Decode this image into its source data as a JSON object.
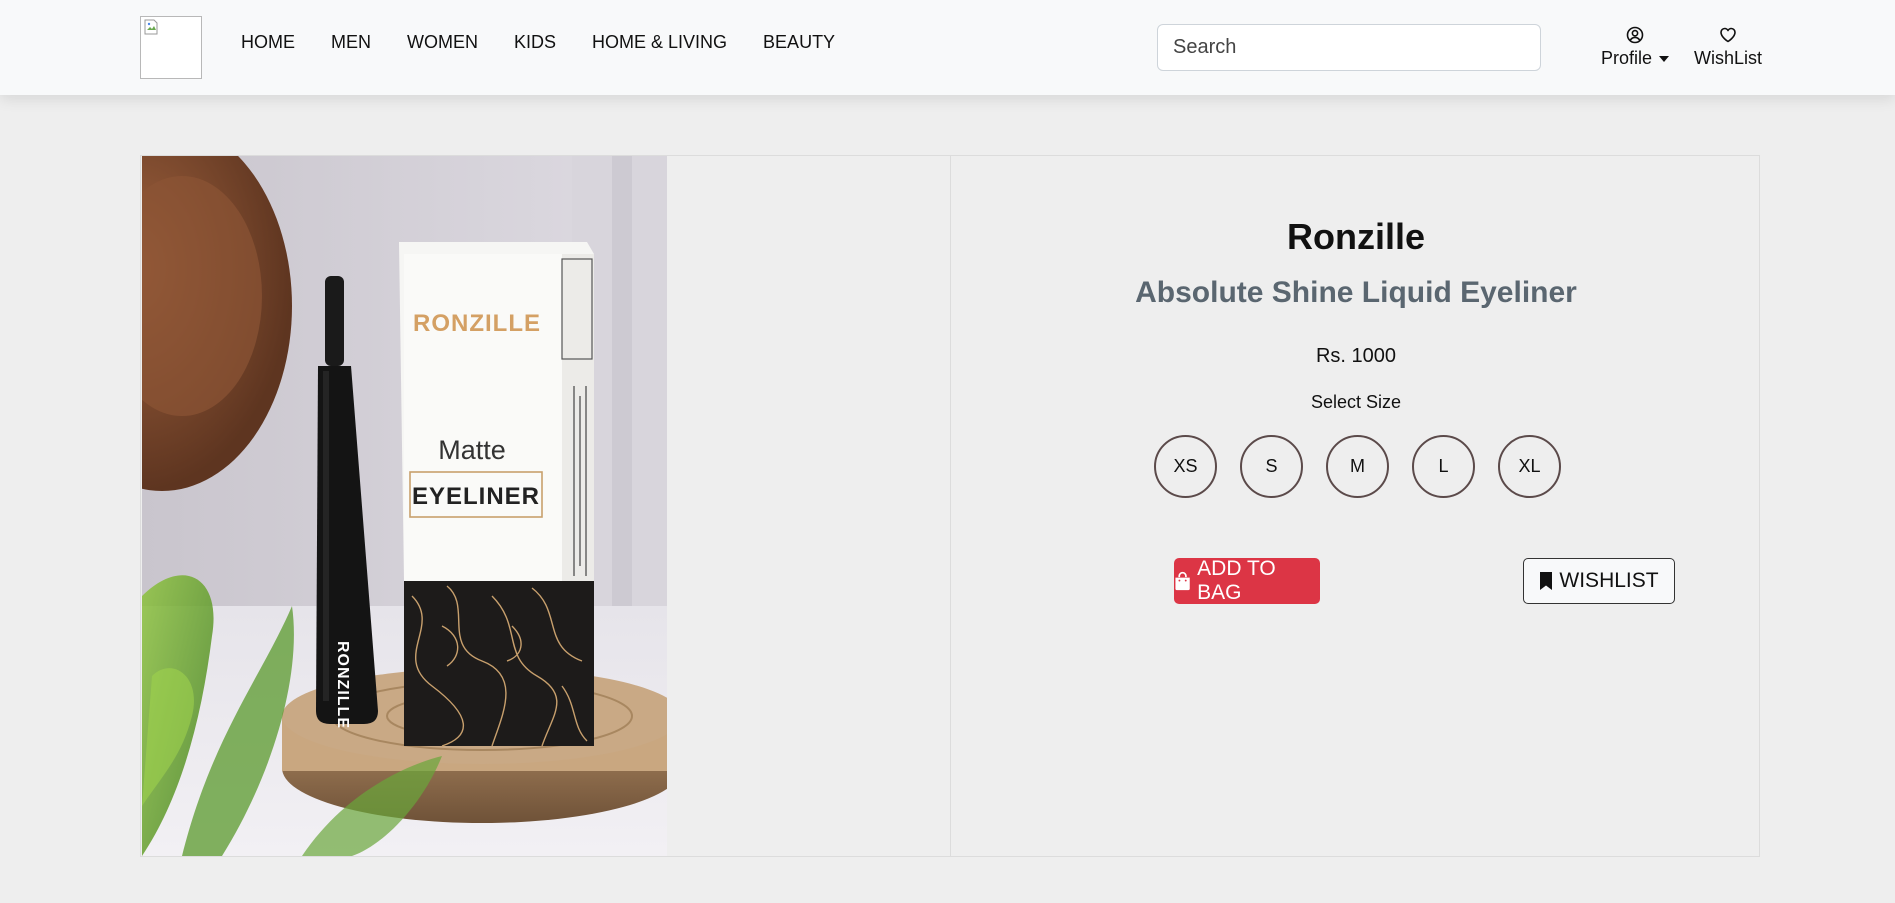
{
  "nav": {
    "links": [
      "HOME",
      "MEN",
      "WOMEN",
      "KIDS",
      "HOME & LIVING",
      "BEAUTY"
    ],
    "search_placeholder": "Search",
    "profile_label": "Profile",
    "wishlist_label": "WishList"
  },
  "product": {
    "brand": "Ronzille",
    "name": "Absolute Shine Liquid Eyeliner",
    "price": "Rs. 1000",
    "size_label": "Select Size",
    "sizes": [
      "XS",
      "S",
      "M",
      "L",
      "XL"
    ],
    "add_to_bag_label": "ADD TO BAG",
    "wishlist_label": "WISHLIST",
    "image": {
      "box_brand": "RONZILLE",
      "box_line1": "Matte",
      "box_line2": "EYELINER",
      "bottle_brand": "RONZILLE"
    }
  },
  "colors": {
    "accent_red": "#dc3545",
    "subtitle_gray": "#5a6670",
    "navbar_bg": "#f8f9fa",
    "page_bg": "#eeeeee"
  },
  "icons": {
    "profile": "user-circle-icon",
    "wishlist_nav": "heart-icon",
    "bag": "shopping-bag-icon",
    "wishlist_btn": "bookmark-icon"
  }
}
